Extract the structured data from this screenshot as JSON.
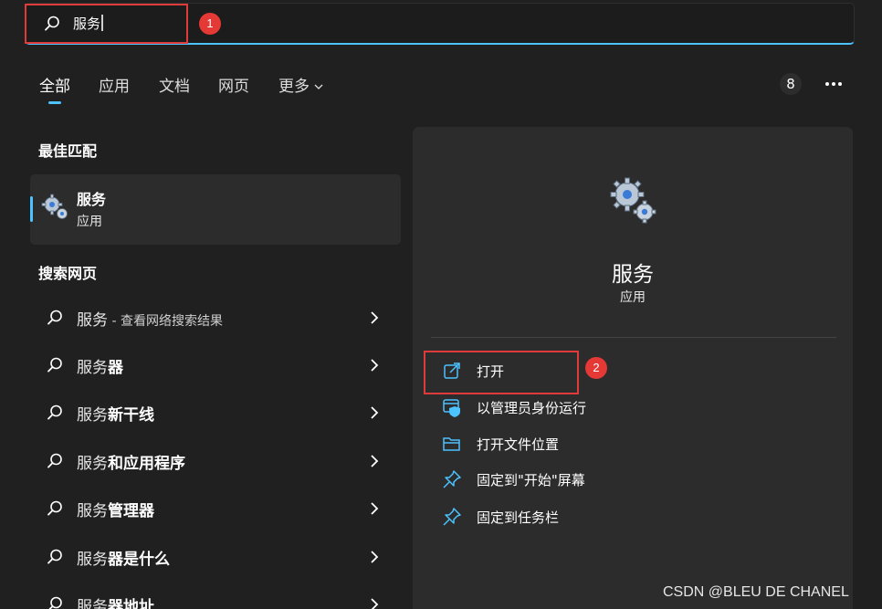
{
  "search": {
    "query": "服务"
  },
  "annotations": {
    "step1": "1",
    "step2": "2"
  },
  "tabs": [
    {
      "label": "全部",
      "active": true
    },
    {
      "label": "应用"
    },
    {
      "label": "文档"
    },
    {
      "label": "网页"
    },
    {
      "label": "更多"
    }
  ],
  "toolbar": {
    "count": "8"
  },
  "best_match": {
    "heading": "最佳匹配",
    "name": "服务",
    "type": "应用"
  },
  "web_search": {
    "heading": "搜索网页",
    "items": [
      {
        "prefix": "服务",
        "suffix": "",
        "hint": " - 查看网络搜索结果"
      },
      {
        "prefix": "服务",
        "suffix": "器",
        "hint": ""
      },
      {
        "prefix": "服务",
        "suffix": "新干线",
        "hint": ""
      },
      {
        "prefix": "服务",
        "suffix": "和应用程序",
        "hint": ""
      },
      {
        "prefix": "服务",
        "suffix": "管理器",
        "hint": ""
      },
      {
        "prefix": "服务",
        "suffix": "器是什么",
        "hint": ""
      },
      {
        "prefix": "服务",
        "suffix": "器地址",
        "hint": ""
      }
    ]
  },
  "detail": {
    "title": "服务",
    "subtitle": "应用",
    "actions": [
      {
        "label": "打开",
        "icon": "open-external-icon"
      },
      {
        "label": "以管理员身份运行",
        "icon": "run-as-admin-icon"
      },
      {
        "label": "打开文件位置",
        "icon": "folder-icon"
      },
      {
        "label": "固定到\"开始\"屏幕",
        "icon": "pin-icon"
      },
      {
        "label": "固定到任务栏",
        "icon": "pin-icon"
      }
    ]
  },
  "watermark": "CSDN @BLEU DE CHANEL",
  "colors": {
    "accent": "#4cc2ff",
    "annotation": "#e53935",
    "background": "#202020",
    "panel": "#2c2c2c"
  }
}
